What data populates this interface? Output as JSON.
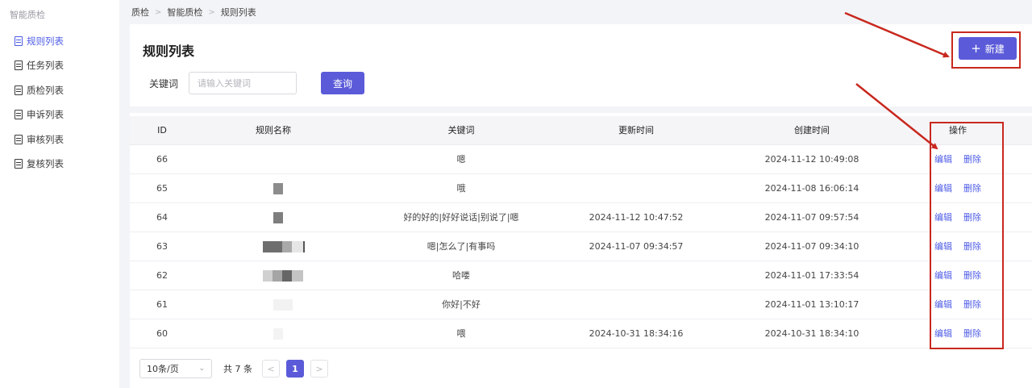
{
  "sidebar": {
    "group": "智能质检",
    "items": [
      {
        "label": "规则列表",
        "active": true
      },
      {
        "label": "任务列表",
        "active": false
      },
      {
        "label": "质检列表",
        "active": false
      },
      {
        "label": "申诉列表",
        "active": false
      },
      {
        "label": "审核列表",
        "active": false
      },
      {
        "label": "复核列表",
        "active": false
      }
    ]
  },
  "breadcrumb": [
    "质检",
    "智能质检",
    "规则列表"
  ],
  "page": {
    "title": "规则列表",
    "new_button": "新建",
    "keyword_label": "关键词",
    "keyword_placeholder": "请输入关键词",
    "query_button": "查询"
  },
  "table": {
    "columns": [
      "ID",
      "规则名称",
      "关键词",
      "更新时间",
      "创建时间",
      "操作"
    ],
    "rows": [
      {
        "id": "66",
        "keyword": "嗯",
        "updated": "",
        "created": "2024-11-12 10:49:08"
      },
      {
        "id": "65",
        "keyword": "哦",
        "updated": "",
        "created": "2024-11-08 16:06:14"
      },
      {
        "id": "64",
        "keyword": "好的好的|好好说话|别说了|嗯",
        "updated": "2024-11-12 10:47:52",
        "created": "2024-11-07 09:57:54"
      },
      {
        "id": "63",
        "keyword": "嗯|怎么了|有事吗",
        "updated": "2024-11-07 09:34:57",
        "created": "2024-11-07 09:34:10"
      },
      {
        "id": "62",
        "keyword": "哈喽",
        "updated": "",
        "created": "2024-11-01 17:33:54"
      },
      {
        "id": "61",
        "keyword": "你好|不好",
        "updated": "",
        "created": "2024-11-01 13:10:17"
      },
      {
        "id": "60",
        "keyword": "喂",
        "updated": "2024-10-31 18:34:16",
        "created": "2024-10-31 18:34:10"
      }
    ],
    "edit_label": "编辑",
    "delete_label": "删除"
  },
  "pagination": {
    "page_size": "10条/页",
    "total": "共 7 条",
    "current_page": "1"
  },
  "colors": {
    "accent": "#5b5bd9",
    "link": "#4e5ce6",
    "annotation": "#c8281e"
  }
}
